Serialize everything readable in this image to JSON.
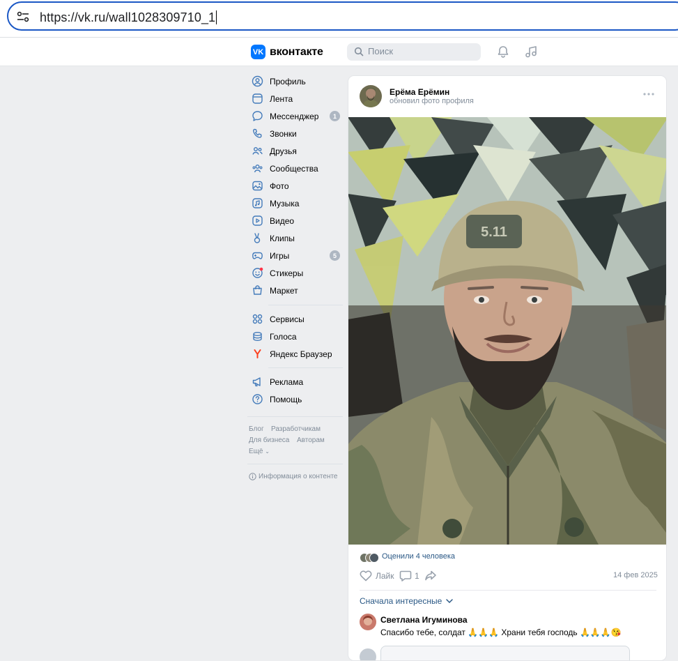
{
  "browser": {
    "url": "https://vk.ru/wall1028309710_1",
    "site_settings_icon": "tune-icon"
  },
  "header": {
    "logo_mark": "VK",
    "logo_text": "вконтакте",
    "search_placeholder": "Поиск",
    "icons": [
      "bell-icon",
      "music-icon"
    ]
  },
  "sidebar": {
    "items": [
      {
        "label": "Профиль",
        "icon": "user-icon"
      },
      {
        "label": "Лента",
        "icon": "news-icon"
      },
      {
        "label": "Мессенджер",
        "icon": "message-icon",
        "badge": "1"
      },
      {
        "label": "Звонки",
        "icon": "phone-icon"
      },
      {
        "label": "Друзья",
        "icon": "friends-icon"
      },
      {
        "label": "Сообщества",
        "icon": "communities-icon"
      },
      {
        "label": "Фото",
        "icon": "photo-icon"
      },
      {
        "label": "Музыка",
        "icon": "music-icon"
      },
      {
        "label": "Видео",
        "icon": "video-icon"
      },
      {
        "label": "Клипы",
        "icon": "clips-icon"
      },
      {
        "label": "Игры",
        "icon": "games-icon",
        "badge": "5"
      },
      {
        "label": "Стикеры",
        "icon": "stickers-icon"
      },
      {
        "label": "Маркет",
        "icon": "market-icon"
      }
    ],
    "items2": [
      {
        "label": "Сервисы",
        "icon": "services-icon"
      },
      {
        "label": "Голоса",
        "icon": "votes-icon"
      },
      {
        "label": "Яндекс Браузер",
        "icon": "yandex-icon"
      }
    ],
    "items3": [
      {
        "label": "Реклама",
        "icon": "ads-icon"
      },
      {
        "label": "Помощь",
        "icon": "help-icon"
      }
    ],
    "footer": {
      "blog": "Блог",
      "developers": "Разработчикам",
      "business": "Для бизнеса",
      "authors": "Авторам",
      "more": "Ещё",
      "content_info": "Информация о контенте"
    }
  },
  "post": {
    "author": "Ерёма Ерёмин",
    "action": "обновил фото профиля",
    "likes_text": "Оценили 4 человека",
    "like_label": "Лайк",
    "comments_count": "1",
    "date": "14 фев 2025",
    "sort_label": "Сначала интересные",
    "comment": {
      "author": "Светлана Игуминова",
      "text": "Спасибо тебе, солдат 🙏🙏🙏 Храни тебя господь 🙏🙏🙏😘"
    }
  }
}
